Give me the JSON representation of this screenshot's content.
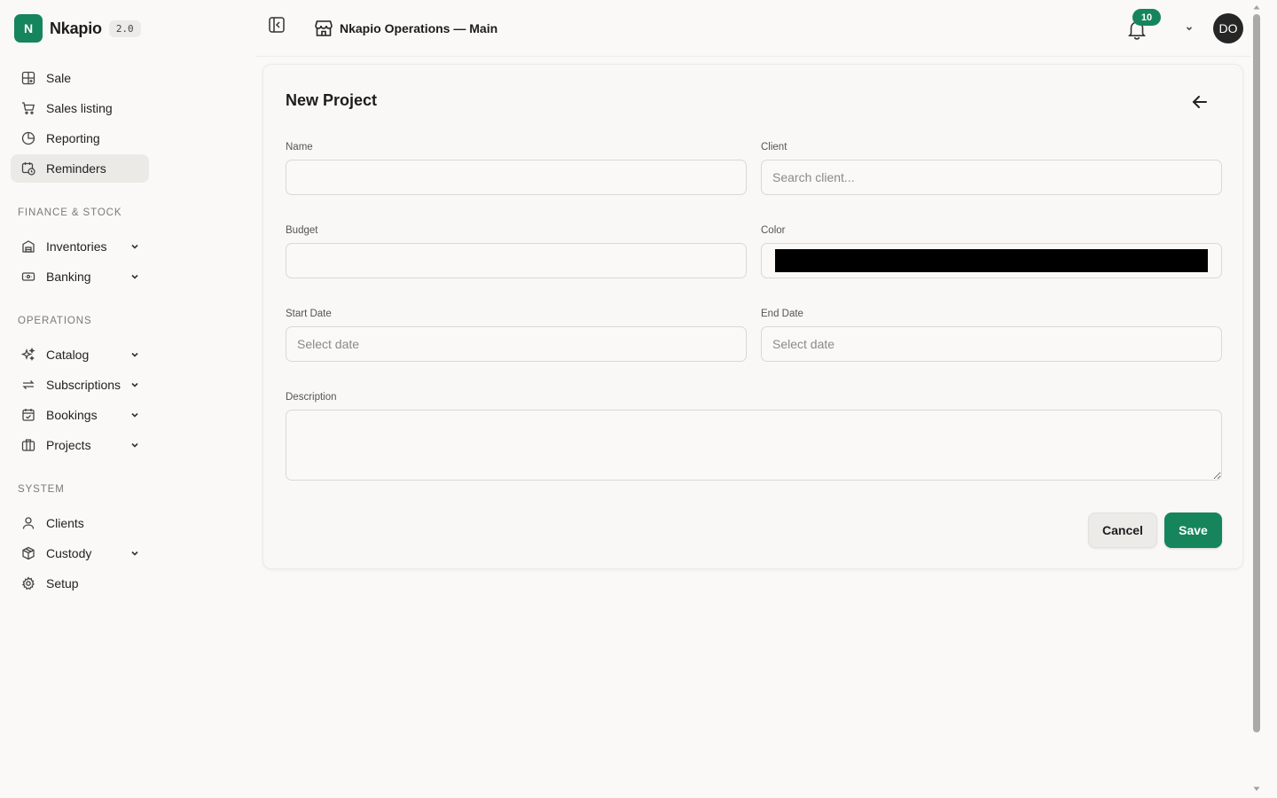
{
  "brand": {
    "logo_letter": "N",
    "name": "Nkapio",
    "version": "2.0",
    "color": "#16855c"
  },
  "sidebar": {
    "top_items": [
      {
        "label": "Sale",
        "icon": "grid-plus-icon"
      },
      {
        "label": "Sales listing",
        "icon": "cart-icon"
      },
      {
        "label": "Reporting",
        "icon": "pie-chart-icon"
      },
      {
        "label": "Reminders",
        "icon": "calendar-clock-icon",
        "active": true
      }
    ],
    "sections": [
      {
        "title": "FINANCE & STOCK",
        "items": [
          {
            "label": "Inventories",
            "icon": "warehouse-icon",
            "expandable": true
          },
          {
            "label": "Banking",
            "icon": "banknote-icon",
            "expandable": true
          }
        ]
      },
      {
        "title": "OPERATIONS",
        "items": [
          {
            "label": "Catalog",
            "icon": "sparkles-icon",
            "expandable": true
          },
          {
            "label": "Subscriptions",
            "icon": "repeat-icon",
            "expandable": true
          },
          {
            "label": "Bookings",
            "icon": "calendar-check-icon",
            "expandable": true
          },
          {
            "label": "Projects",
            "icon": "columns-icon",
            "expandable": true
          }
        ]
      },
      {
        "title": "SYSTEM",
        "items": [
          {
            "label": "Clients",
            "icon": "user-icon",
            "expandable": false
          },
          {
            "label": "Custody",
            "icon": "package-icon",
            "expandable": true
          },
          {
            "label": "Setup",
            "icon": "gear-icon",
            "expandable": false
          }
        ]
      }
    ]
  },
  "topbar": {
    "store_name": "Nkapio Operations — Main",
    "notification_count": "10",
    "avatar_initials": "DO"
  },
  "form": {
    "title": "New Project",
    "name_label": "Name",
    "name_value": "",
    "client_label": "Client",
    "client_placeholder": "Search client...",
    "budget_label": "Budget",
    "budget_value": "",
    "color_label": "Color",
    "color_value": "#000000",
    "start_date_label": "Start Date",
    "start_date_placeholder": "Select date",
    "end_date_label": "End Date",
    "end_date_placeholder": "Select date",
    "description_label": "Description",
    "description_value": "",
    "cancel_label": "Cancel",
    "save_label": "Save"
  }
}
